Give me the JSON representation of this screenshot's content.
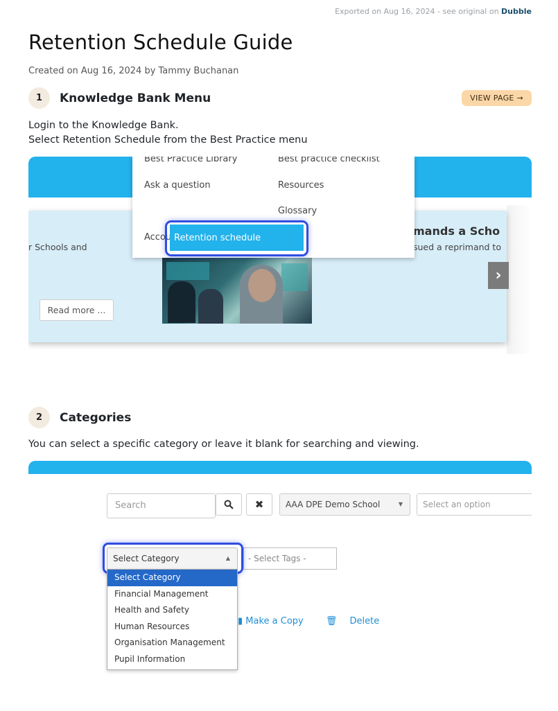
{
  "export_note": {
    "prefix": "Exported on Aug 16, 2024 - see original on",
    "source": "Dubble"
  },
  "title": "Retention Schedule Guide",
  "meta": "Created on Aug 16, 2024 by Tammy Buchanan",
  "steps": [
    {
      "number": "1",
      "title": "Knowledge Bank Menu",
      "button": "VIEW PAGE →",
      "lines": [
        "Login to the Knowledge Bank.",
        "Select Retention Schedule from the Best Practice menu"
      ],
      "screenshot": {
        "menu_items": [
          "Best Practice Library",
          "Best practice checklist",
          "Ask a question",
          "Resources",
          "Glossary",
          "Accountability Tracking",
          "Retention schedule"
        ],
        "left_text": "r Schools and",
        "read_more": "Read more ...",
        "right_heading": "mands a Scho",
        "right_sub": "sued a reprimand to",
        "arrow": "›"
      }
    },
    {
      "number": "2",
      "title": "Categories",
      "lines": [
        "You can select a specific category or leave it blank for searching and viewing."
      ],
      "screenshot": {
        "search_placeholder": "Search",
        "school": "AAA DPE Demo School",
        "option_placeholder": "Select an option",
        "category": "Select Category",
        "tags": "- Select Tags -",
        "dropdown": [
          "Select Category",
          "Financial Management",
          "Health and Safety",
          "Human Resources",
          "Organisation Management",
          "Pupil Information"
        ],
        "actions": [
          "Make a Copy",
          "Delete"
        ]
      }
    }
  ]
}
